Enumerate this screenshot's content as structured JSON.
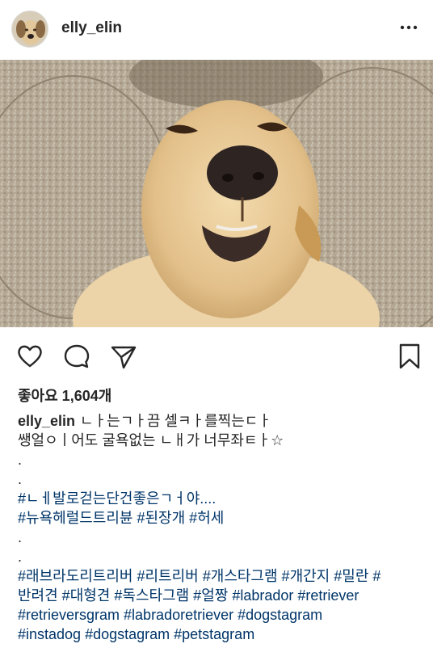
{
  "post": {
    "username": "elly_elin",
    "likes_text": "좋아요 1,604개",
    "caption_line1": "ㄴㅏ는ㄱㅏ끔 셀ㅋㅏ를찍는ㄷㅏ",
    "caption_line2": "쌩얼ㅇㅣ어도 굴욕없는 ㄴㅐ가 너무좌ㅌㅏ☆",
    "dot1": ".",
    "dot2": ".",
    "caption_line5": "#ㄴㅔ발로걷는단건좋은ㄱㅓ야....",
    "caption_line6": "#뉴욕헤럴드트리뷴 #된장개 #허세",
    "dot3": ".",
    "dot4": ".",
    "hashtags_line1": "#래브라도리트리버 #리트리버 #개스타그램 #개간지 #밀란 #",
    "hashtags_line2": "반려견 #대형견 #독스타그램 #얼짱 #labrador #retriever",
    "hashtags_line3": "#retrieversgram #labradoretriever #dogstagram",
    "hashtags_line4": "#instadog #dogstagram #petstagram"
  },
  "icons": {
    "more": "more-options-icon",
    "like": "heart-icon",
    "comment": "comment-icon",
    "share": "share-icon",
    "save": "bookmark-icon"
  },
  "colors": {
    "text": "#262626",
    "hashtag": "#003569"
  }
}
